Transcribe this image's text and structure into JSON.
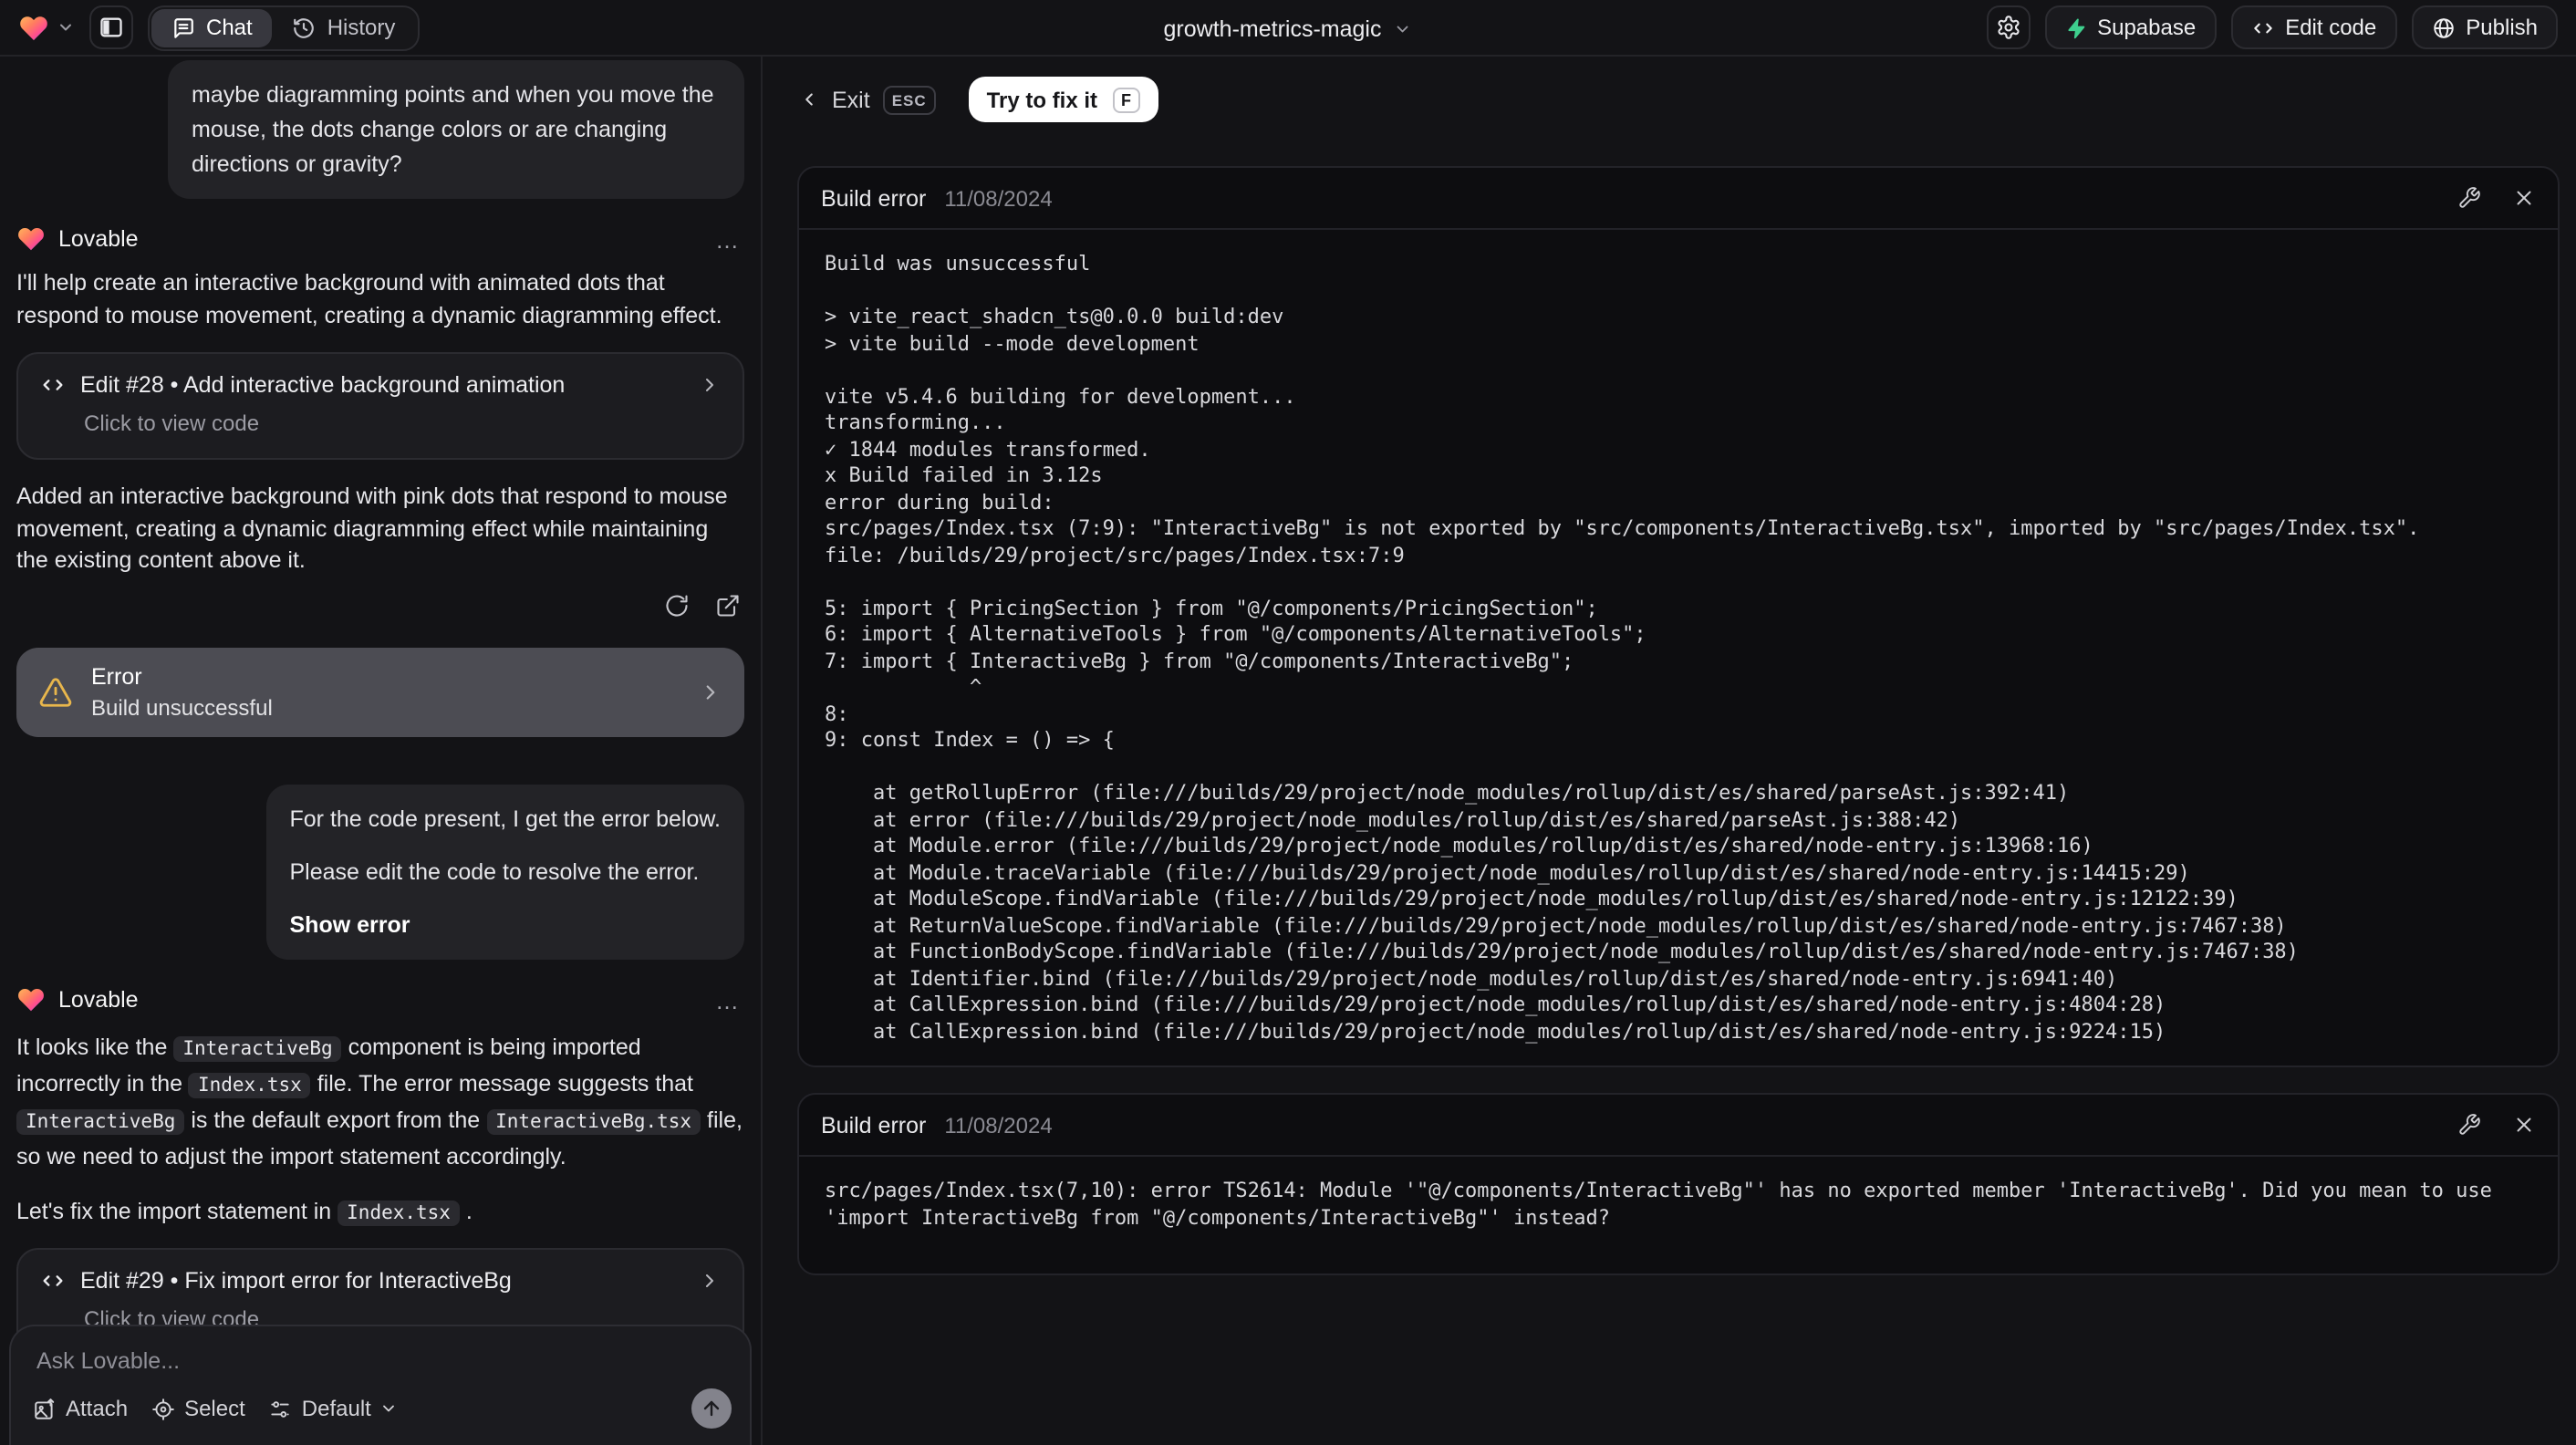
{
  "colors": {
    "supabase_green": "#3ecf8e",
    "warning_amber": "#e8b64c",
    "heart_gradient": [
      "#ffb65c",
      "#ff7e5f",
      "#ff4d8f",
      "#6f7bff"
    ],
    "fix_button_bg": "#ffffff"
  },
  "topbar": {
    "project_name": "growth-metrics-magic",
    "chat_tab": "Chat",
    "history_tab": "History",
    "supabase_button": "Supabase",
    "edit_code_button": "Edit code",
    "publish_button": "Publish"
  },
  "chat": {
    "assistant_name": "Lovable",
    "menu_ellipsis": "…",
    "user_message_1": "maybe diagramming points and when you move the mouse, the dots change colors or are changing directions or gravity?",
    "assistant_message_1": "I'll help create an interactive background with animated dots that respond to mouse movement, creating a dynamic diagramming effect.",
    "edit_card_1": {
      "title": "Edit #28 • Add interactive background animation",
      "subtitle": "Click to view code"
    },
    "assistant_message_2": "Added an interactive background with pink dots that respond to mouse movement, creating a dynamic diagramming effect while maintaining the existing content above it.",
    "error_card": {
      "title": "Error",
      "subtitle": "Build unsuccessful"
    },
    "user_message_2": {
      "para1": "For the code present, I get the error below.",
      "para2": "Please edit the code to resolve the error.",
      "action": "Show error"
    },
    "assistant_message_3_p1": [
      {
        "text": "It looks like the "
      },
      {
        "text": "InteractiveBg",
        "code": true
      },
      {
        "text": " component is being imported incorrectly in the "
      },
      {
        "text": "Index.tsx",
        "code": true
      },
      {
        "text": " file. The error message suggests that "
      },
      {
        "text": "InteractiveBg",
        "code": true
      },
      {
        "text": " is the default export from the "
      },
      {
        "text": "InteractiveBg.tsx",
        "code": true
      },
      {
        "text": " file, so we need to adjust the import statement accordingly."
      }
    ],
    "assistant_message_3_p2": [
      {
        "text": "Let's fix the import statement in "
      },
      {
        "text": "Index.tsx",
        "code": true
      },
      {
        "text": " ."
      }
    ],
    "edit_card_2": {
      "title": "Edit #29 • Fix import error for InteractiveBg",
      "subtitle": "Click to view code"
    }
  },
  "composer": {
    "placeholder": "Ask Lovable...",
    "attach_label": "Attach",
    "select_label": "Select",
    "mode_label": "Default"
  },
  "fix_panel": {
    "exit_label": "Exit",
    "esc_key": "ESC",
    "fix_button_label": "Try to fix it",
    "fix_key": "F",
    "build_errors": [
      {
        "title": "Build error",
        "date": "11/08/2024",
        "log": "Build was unsuccessful\n\n> vite_react_shadcn_ts@0.0.0 build:dev\n> vite build --mode development\n\nvite v5.4.6 building for development...\ntransforming...\n✓ 1844 modules transformed.\nx Build failed in 3.12s\nerror during build:\nsrc/pages/Index.tsx (7:9): \"InteractiveBg\" is not exported by \"src/components/InteractiveBg.tsx\", imported by \"src/pages/Index.tsx\".\nfile: /builds/29/project/src/pages/Index.tsx:7:9\n\n5: import { PricingSection } from \"@/components/PricingSection\";\n6: import { AlternativeTools } from \"@/components/AlternativeTools\";\n7: import { InteractiveBg } from \"@/components/InteractiveBg\";\n            ^\n8: \n9: const Index = () => {\n\n    at getRollupError (file:///builds/29/project/node_modules/rollup/dist/es/shared/parseAst.js:392:41)\n    at error (file:///builds/29/project/node_modules/rollup/dist/es/shared/parseAst.js:388:42)\n    at Module.error (file:///builds/29/project/node_modules/rollup/dist/es/shared/node-entry.js:13968:16)\n    at Module.traceVariable (file:///builds/29/project/node_modules/rollup/dist/es/shared/node-entry.js:14415:29)\n    at ModuleScope.findVariable (file:///builds/29/project/node_modules/rollup/dist/es/shared/node-entry.js:12122:39)\n    at ReturnValueScope.findVariable (file:///builds/29/project/node_modules/rollup/dist/es/shared/node-entry.js:7467:38)\n    at FunctionBodyScope.findVariable (file:///builds/29/project/node_modules/rollup/dist/es/shared/node-entry.js:7467:38)\n    at Identifier.bind (file:///builds/29/project/node_modules/rollup/dist/es/shared/node-entry.js:6941:40)\n    at CallExpression.bind (file:///builds/29/project/node_modules/rollup/dist/es/shared/node-entry.js:4804:28)\n    at CallExpression.bind (file:///builds/29/project/node_modules/rollup/dist/es/shared/node-entry.js:9224:15)"
      },
      {
        "title": "Build error",
        "date": "11/08/2024",
        "log": "src/pages/Index.tsx(7,10): error TS2614: Module '\"@/components/InteractiveBg\"' has no exported member 'InteractiveBg'. Did you mean to use 'import InteractiveBg from \"@/components/InteractiveBg\"' instead?"
      }
    ]
  }
}
